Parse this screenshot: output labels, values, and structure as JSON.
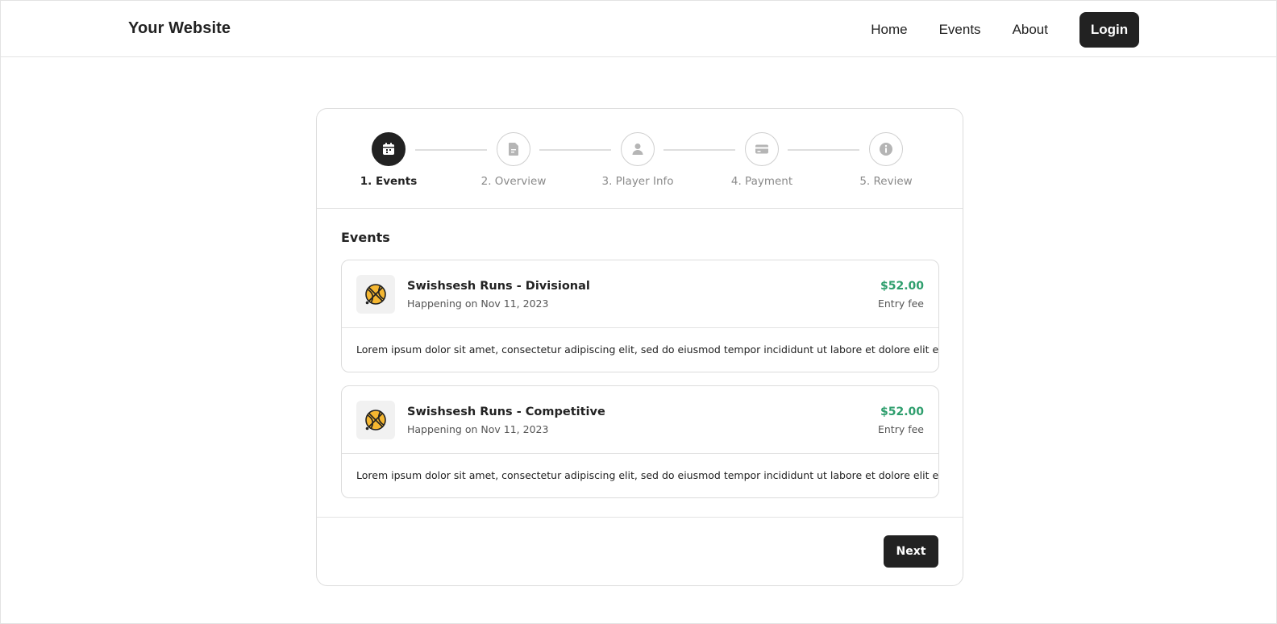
{
  "header": {
    "brand": "Your Website",
    "nav": [
      "Home",
      "Events",
      "About"
    ],
    "login_label": "Login"
  },
  "stepper": {
    "steps": [
      {
        "label": "1. Events",
        "icon": "calendar-icon",
        "active": true
      },
      {
        "label": "2. Overview",
        "icon": "document-icon",
        "active": false
      },
      {
        "label": "3. Player Info",
        "icon": "user-icon",
        "active": false
      },
      {
        "label": "4. Payment",
        "icon": "credit-card-icon",
        "active": false
      },
      {
        "label": "5. Review",
        "icon": "info-icon",
        "active": false
      }
    ]
  },
  "events_section": {
    "title": "Events",
    "items": [
      {
        "icon": "basketball-icon",
        "title": "Swishsesh Runs - Divisional",
        "date": "Happening on Nov 11, 2023",
        "price": "$52.00",
        "price_label": "Entry fee",
        "description": "Lorem ipsum dolor sit amet, consectetur adipiscing elit, sed do eiusmod tempor incididunt ut labore et dolore elit eiusmod"
      },
      {
        "icon": "basketball-icon",
        "title": "Swishsesh Runs - Competitive",
        "date": "Happening on Nov 11, 2023",
        "price": "$52.00",
        "price_label": "Entry fee",
        "description": "Lorem ipsum dolor sit amet, consectetur adipiscing elit, sed do eiusmod tempor incididunt ut labore et dolore elit eiusmod"
      }
    ]
  },
  "footer": {
    "next_label": "Next"
  },
  "colors": {
    "primary": "#222222",
    "price": "#2e9e6d",
    "muted": "#8a8a8a",
    "border": "#dcdcdc"
  }
}
